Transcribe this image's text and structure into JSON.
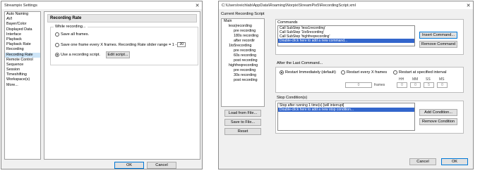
{
  "settings_window": {
    "title": "Streampix Settings",
    "nav_items": [
      "Auto Naming",
      "AVI",
      "Bayer/Color",
      "Displayed Data",
      "Interface",
      "Playback",
      "Playback Rate",
      "Recording",
      "Recording Rate",
      "Remote Control",
      "Sequence",
      "Session",
      "Timeshifting",
      "Workspace(s)",
      "More..."
    ],
    "selected_nav": "Recording Rate",
    "panel_title": "Recording Rate",
    "group_label": "While recording...",
    "option_all": "Save all frames.",
    "option_every": "Save one frame every X frames.  Recording Rate slider range = 1 -",
    "every_value": "30",
    "option_script": "Use a recording script.",
    "edit_script_label": "Edit script...",
    "ok_label": "OK",
    "cancel_label": "Cancel"
  },
  "script_window": {
    "title": "C:\\Users\\reichlab\\AppData\\Roaming\\Norpix\\StreamPix5\\RecordingScript.xml",
    "current_script_label": "Current Recording Script",
    "tree": [
      "Main",
      "less|recording",
      "pre recording",
      "180s recording",
      "after recordir",
      "1to5recording",
      "pre recording",
      "60s recording",
      "post recording",
      "highfreqrecording",
      "pre recording",
      "30s recording",
      "post recording"
    ],
    "commands_label": "Commands",
    "commands": [
      "Call SubStep 'less1recording'",
      "Call SubStep '1to5recording'",
      "Call SubStep 'highfreqrecording'",
      "Double-click here to add a new command..."
    ],
    "insert_command_label": "Insert Command...",
    "remove_command_label": "Remove Command",
    "after_last_label": "After the Last Command...",
    "restart_immediately": "Restart Immediately (default)",
    "restart_every": "Restart every X frames",
    "restart_interval": "Restart at specified interval",
    "frames_value": "0",
    "frames_label": "frames",
    "hh_label": "HH",
    "mm_label": "MM",
    "ss_label": "SS",
    "ms_label": "MS",
    "hh_value": "0",
    "mm_value": "0",
    "ss_value": "5",
    "ms_value": "0",
    "stop_label": "Stop Condition(s)",
    "stop_items": [
      "Stop after running 1 time(s) [will interrupt]",
      "Double-click here to add a new stop condition..."
    ],
    "add_condition_label": "Add Condition...",
    "remove_condition_label": "Remove Condition",
    "load_label": "Load from File...",
    "save_label": "Save to File...",
    "reset_label": "Reset",
    "cancel_label": "Cancel",
    "ok_label": "OK"
  }
}
